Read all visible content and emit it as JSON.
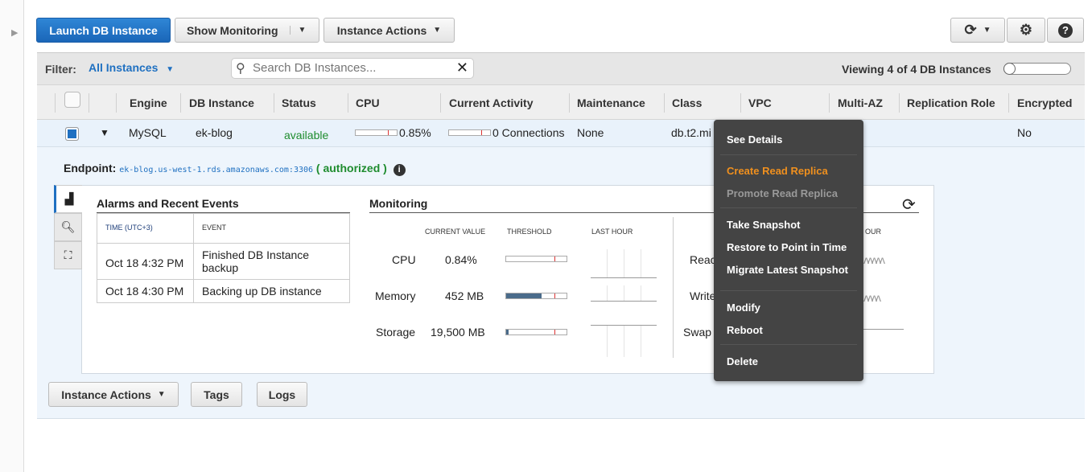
{
  "toolbar": {
    "launch": "Launch DB Instance",
    "show_monitoring": "Show Monitoring",
    "instance_actions": "Instance Actions"
  },
  "filter": {
    "label": "Filter:",
    "value": "All Instances",
    "search_placeholder": "Search DB Instances...",
    "viewing": "Viewing 4 of 4 DB Instances"
  },
  "columns": [
    "Engine",
    "DB Instance",
    "Status",
    "CPU",
    "Current Activity",
    "Maintenance",
    "Class",
    "VPC",
    "Multi-AZ",
    "Replication Role",
    "Encrypted"
  ],
  "row": {
    "engine": "MySQL",
    "instance": "ek-blog",
    "status": "available",
    "cpu": "0.85%",
    "activity": "0 Connections",
    "maintenance": "None",
    "class": "db.t2.mi",
    "encrypted": "No"
  },
  "endpoint": {
    "label": "Endpoint:",
    "value": "ek-blog.us-west-1.rds.amazonaws.com:3306",
    "auth": "( authorized )"
  },
  "alarms": {
    "title": "Alarms and Recent Events",
    "col_time": "TIME (UTC+3)",
    "col_event": "EVENT",
    "events": [
      {
        "time": "Oct 18 4:32 PM",
        "event": "Finished DB Instance backup"
      },
      {
        "time": "Oct 18 4:30 PM",
        "event": "Backing up DB instance"
      }
    ]
  },
  "monitoring": {
    "title": "Monitoring",
    "h_current": "CURRENT VALUE",
    "h_threshold": "THRESHOLD",
    "h_last": "LAST HOUR",
    "h_last2": "OUR",
    "metrics": [
      {
        "name": "CPU",
        "value": "0.84%",
        "fill": 0.01
      },
      {
        "name": "Memory",
        "value": "452 MB",
        "fill": 0.6
      },
      {
        "name": "Storage",
        "value": "19,500 MB",
        "fill": 0.03
      }
    ],
    "right_metrics": [
      "Reac",
      "Write",
      "Swap"
    ]
  },
  "menu": {
    "items": [
      "See Details",
      "Create Read Replica",
      "Promote Read Replica",
      "Take Snapshot",
      "Restore to Point in Time",
      "Migrate Latest Snapshot",
      "Modify",
      "Reboot",
      "Delete"
    ],
    "highlight_color": "#f0901e"
  },
  "bottom": {
    "instance_actions": "Instance Actions",
    "tags": "Tags",
    "logs": "Logs"
  },
  "colors": {
    "primary": "#1f70c1",
    "status_ok": "#1e8c2e"
  }
}
